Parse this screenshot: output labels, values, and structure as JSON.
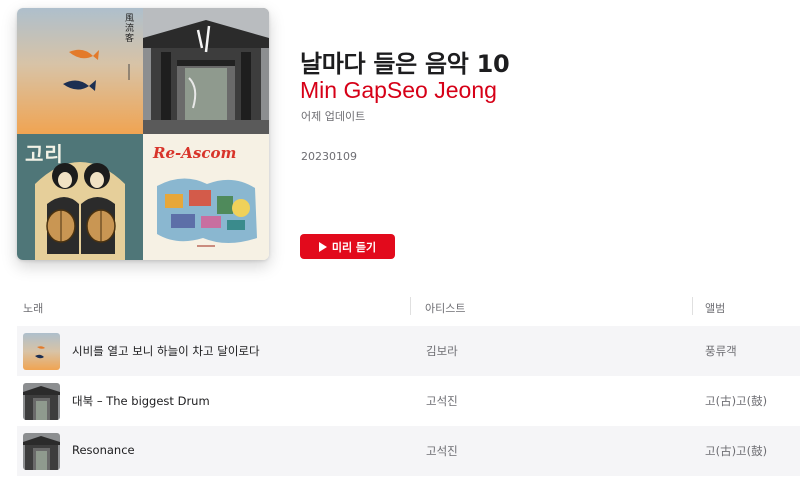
{
  "playlist": {
    "title": "날마다 들은 음악 10",
    "curator": "Min GapSeo Jeong",
    "updated": "어제 업데이트",
    "description": "20230109",
    "preview_label": "미리 듣기"
  },
  "artwork": {
    "tile1_text": "風流客",
    "tile1_subtext": "김보라",
    "tile3_text": "고리",
    "tile4_text": "Re-Ascom"
  },
  "table": {
    "headers": {
      "song": "노래",
      "artist": "아티스트",
      "album": "앨범"
    },
    "rows": [
      {
        "title": "시비를 열고 보니 하늘이 차고 달이로다",
        "artist": "김보라",
        "album": "풍류객"
      },
      {
        "title": "대북 – The biggest Drum",
        "artist": "고석진",
        "album": "고(古)고(鼓)"
      },
      {
        "title": "Resonance",
        "artist": "고석진",
        "album": "고(古)고(鼓)"
      }
    ]
  },
  "colors": {
    "accent": "#d60017",
    "button": "#e20a1c",
    "row_shade": "#f5f5f7"
  },
  "icons": {
    "preview": "play-icon"
  }
}
